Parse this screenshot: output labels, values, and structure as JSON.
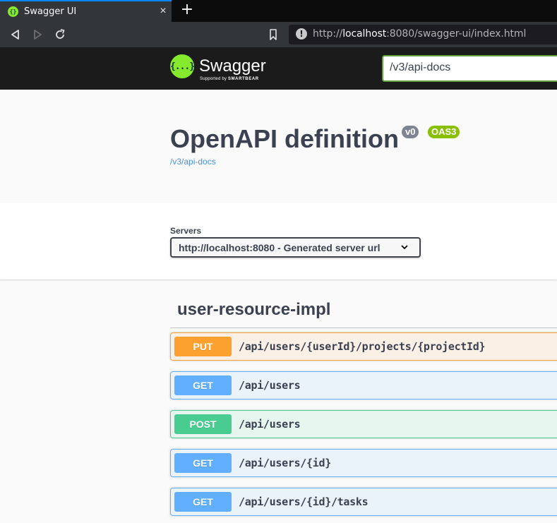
{
  "browser": {
    "tab_title": "Swagger UI",
    "new_tab_label": "+",
    "close_tab_label": "×",
    "url_prefix": "http://",
    "url_host": "localhost",
    "url_rest": ":8080/swagger-ui/index.html",
    "info_icon_glyph": "!"
  },
  "topbar": {
    "logo_glyph": "{...}",
    "logo_text": "Swagger",
    "logo_sub_prefix": "Supported by ",
    "logo_sub_brand": "SMARTBEAR",
    "explore_value": "/v3/api-docs",
    "accent_color": "#85ea2d"
  },
  "info": {
    "title": "OpenAPI definition",
    "version_badge": "v0",
    "oas_badge": "OAS3",
    "spec_link": "/v3/api-docs"
  },
  "servers": {
    "label": "Servers",
    "selected": "http://localhost:8080 - Generated server url"
  },
  "tag": {
    "name": "user-resource-impl"
  },
  "operations": [
    {
      "method": "PUT",
      "path": "/api/users/{userId}/projects/{projectId}",
      "color": "#fca130"
    },
    {
      "method": "GET",
      "path": "/api/users",
      "color": "#61affe"
    },
    {
      "method": "POST",
      "path": "/api/users",
      "color": "#49cc90"
    },
    {
      "method": "GET",
      "path": "/api/users/{id}",
      "color": "#61affe"
    },
    {
      "method": "GET",
      "path": "/api/users/{id}/tasks",
      "color": "#61affe"
    }
  ]
}
